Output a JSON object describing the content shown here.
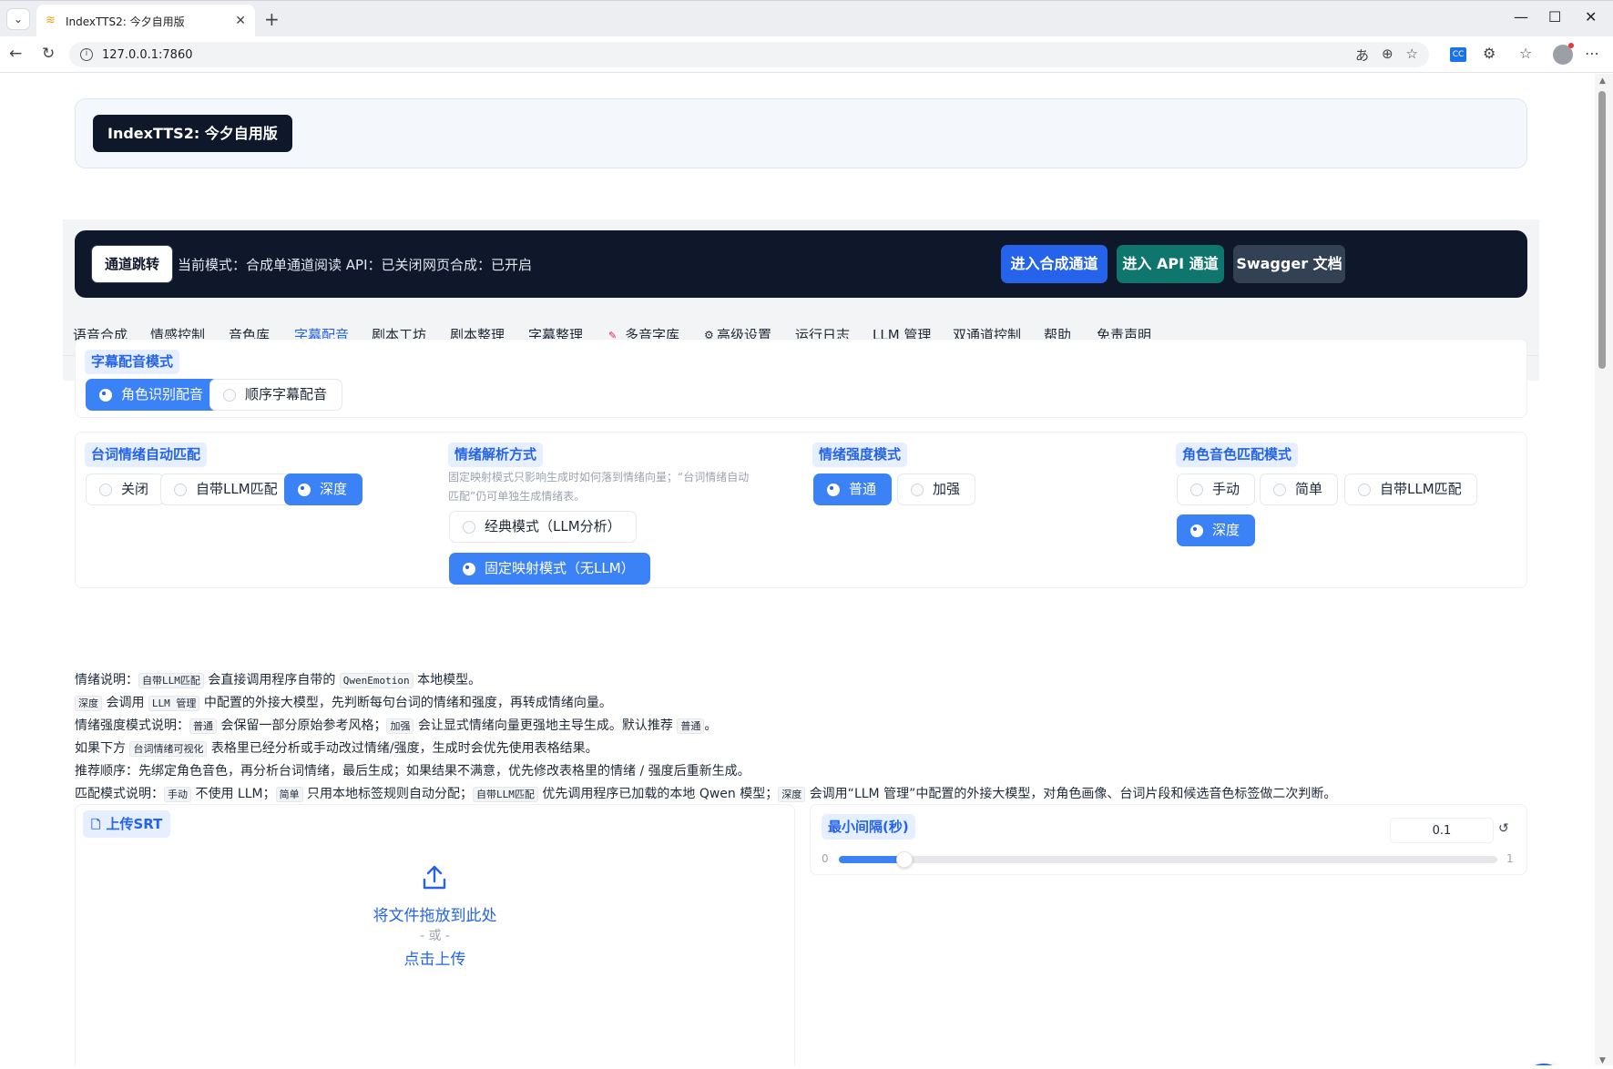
{
  "browser": {
    "tab_title": "IndexTTS2: 今夕自用版",
    "url": "127.0.0.1:7860"
  },
  "header": {
    "brand": "IndexTTS2: 今夕自用版"
  },
  "channel": {
    "jump_label": "通道跳转",
    "mode_text": "当前模式：合成单通道",
    "api_text": "阅读 API：已关闭",
    "web_text": "网页合成：已开启",
    "btn_synth": "进入合成通道",
    "btn_api": "进入 API 通道",
    "btn_swagger": "Swagger 文档"
  },
  "tabs": [
    "语音合成",
    "情感控制",
    "音色库",
    "字幕配音",
    "剧本工坊",
    "剧本整理",
    "字幕整理",
    "多音字库",
    "高级设置",
    "运行日志",
    "LLM 管理",
    "双通道控制",
    "帮助",
    "免责声明"
  ],
  "tab_active": "字幕配音",
  "dub_mode": {
    "label": "字幕配音模式",
    "options": [
      "角色识别配音",
      "顺序字幕配音"
    ],
    "selected": "角色识别配音"
  },
  "auto_match": {
    "label": "台词情绪自动匹配",
    "options": [
      "关闭",
      "自带LLM匹配",
      "深度"
    ],
    "selected": "深度"
  },
  "parse_mode": {
    "label": "情绪解析方式",
    "hint": "固定映射模式只影响生成时如何落到情绪向量；“台词情绪自动匹配”仍可单独生成情绪表。",
    "options": [
      "经典模式（LLM分析）",
      "固定映射模式（无LLM）"
    ],
    "selected": "固定映射模式（无LLM）"
  },
  "intensity_mode": {
    "label": "情绪强度模式",
    "options": [
      "普通",
      "加强"
    ],
    "selected": "普通"
  },
  "voice_match": {
    "label": "角色音色匹配模式",
    "options": [
      "手动",
      "简单",
      "自带LLM匹配",
      "深度"
    ],
    "selected": "深度"
  },
  "description": {
    "l1_a": "情绪说明：",
    "l1_c1": "自带LLM匹配",
    "l1_b": "会直接调用程序自带的",
    "l1_c2": "QwenEmotion",
    "l1_c": "本地模型。",
    "l2_c1": "深度",
    "l2_a": "会调用",
    "l2_c2": "LLM 管理",
    "l2_b": "中配置的外接大模型，先判断每句台词的情绪和强度，再转成情绪向量。",
    "l3_a": "情绪强度模式说明：",
    "l3_c1": "普通",
    "l3_b": "会保留一部分原始参考风格；",
    "l3_c2": "加强",
    "l3_c": "会让显式情绪向量更强地主导生成。默认推荐",
    "l3_c3": "普通",
    "l3_d": "。",
    "l4_a": "如果下方",
    "l4_c1": "台词情绪可视化",
    "l4_b": "表格里已经分析或手动改过情绪/强度，生成时会优先使用表格结果。",
    "l5": "推荐顺序：先绑定角色音色，再分析台词情绪，最后生成；如果结果不满意，优先修改表格里的情绪 / 强度后重新生成。",
    "l6_a": "匹配模式说明：",
    "l6_c1": "手动",
    "l6_b": "不使用 LLM；",
    "l6_c2": "简单",
    "l6_c": "只用本地标签规则自动分配；",
    "l6_c3": "自带LLM匹配",
    "l6_d": "优先调用程序已加载的本地 Qwen 模型；",
    "l6_c4": "深度",
    "l6_e": "会调用“LLM 管理”中配置的外接大模型，对角色画像、台词片段和候选音色标签做二次判断。"
  },
  "upload": {
    "label": "上传SRT",
    "drop_text": "将文件拖放到此处",
    "or_text": "- 或 -",
    "click_text": "点击上传"
  },
  "min_gap": {
    "label": "最小间隔(秒)",
    "value": "0.1",
    "min": "0",
    "max": "1",
    "fraction": 0.1
  },
  "colors": {
    "accent": "#3b82f6",
    "dark": "#0f172a",
    "teal": "#0f766e",
    "slate": "#334155"
  }
}
